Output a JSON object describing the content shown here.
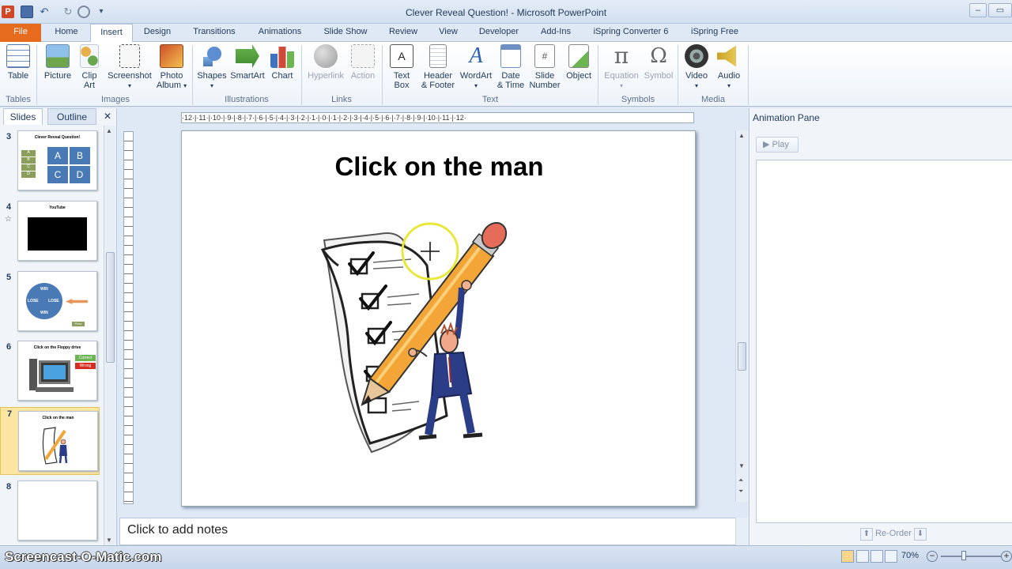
{
  "window": {
    "title": "Clever Reveal Question! - Microsoft PowerPoint",
    "controls": [
      "–",
      "▭",
      "✕"
    ]
  },
  "ribbon_tabs": [
    "File",
    "Home",
    "Insert",
    "Design",
    "Transitions",
    "Animations",
    "Slide Show",
    "Review",
    "View",
    "Developer",
    "Add-Ins",
    "iSpring Converter 6",
    "iSpring Free"
  ],
  "active_tab": "Insert",
  "ribbon": {
    "groups": {
      "tables": "Tables",
      "images": "Images",
      "illustrations": "Illustrations",
      "links": "Links",
      "text": "Text",
      "symbols": "Symbols",
      "media": "Media"
    },
    "table": "Table",
    "picture": "Picture",
    "clip_art_1": "Clip",
    "clip_art_2": "Art",
    "screenshot": "Screenshot",
    "photo_album_1": "Photo",
    "photo_album_2": "Album",
    "shapes": "Shapes",
    "smartart": "SmartArt",
    "chart": "Chart",
    "hyperlink": "Hyperlink",
    "action": "Action",
    "text_box_1": "Text",
    "text_box_2": "Box",
    "header_footer_1": "Header",
    "header_footer_2": "& Footer",
    "wordart": "WordArt",
    "date_time_1": "Date",
    "date_time_2": "& Time",
    "slide_number_1": "Slide",
    "slide_number_2": "Number",
    "object": "Object",
    "equation": "Equation",
    "symbol": "Symbol",
    "video": "Video",
    "audio": "Audio"
  },
  "left_pane": {
    "tab_slides": "Slides",
    "tab_outline": "Outline",
    "close": "✕",
    "slides": [
      {
        "num": "3",
        "title": "Clever Reveal Question!",
        "cells": [
          "A",
          "B",
          "C",
          "D"
        ],
        "side": [
          "A",
          "B",
          "C",
          "D"
        ]
      },
      {
        "num": "4",
        "title": "YouTube"
      },
      {
        "num": "5",
        "words": [
          "WIN",
          "LOSE",
          "LOSE",
          "WIN"
        ],
        "tag": "Prize"
      },
      {
        "num": "6",
        "title": "Click on the Floppy drive",
        "badges": [
          "Correct",
          "Wrong"
        ]
      },
      {
        "num": "7",
        "title": "Click on the man"
      },
      {
        "num": "8"
      }
    ]
  },
  "ruler_text": "·12·|·11·|·10·|·9·|·8·|·7·|·6·|·5·|·4·|·3·|·2·|·1·|·0·|·1·|·2·|·3·|·4·|·5·|·6·|·7·|·8·|·9·|·10·|·11·|·12·",
  "slide": {
    "title": "Click on the man"
  },
  "notes_placeholder": "Click to add notes",
  "animation_pane": {
    "title": "Animation Pane",
    "play": "Play",
    "reorder": "Re-Order"
  },
  "status": {
    "watermark": "Screencast-O-Matic.com",
    "zoom": "70%"
  },
  "colors": {
    "file_tab": "#e76b1f",
    "ribbon_bg": "#ffffff",
    "frame_bg": "#dfe9f5",
    "thumb_blue": "#4a7ab5",
    "thumb_green": "#8aa05a",
    "pencil": "#f3a637",
    "highlight_ring": "#e8e83a",
    "suit_blue": "#2a3d86"
  }
}
